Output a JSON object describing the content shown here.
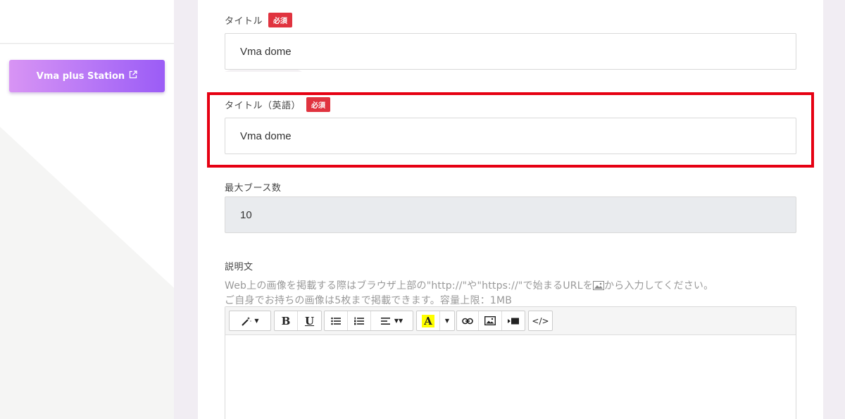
{
  "sidebar": {
    "station_button": {
      "label": "Vma plus Station",
      "icon": "external-link-icon"
    }
  },
  "form": {
    "title": {
      "label": "タイトル",
      "required_badge": "必須",
      "value": "Vma dome"
    },
    "title_en": {
      "label": "タイトル（英語）",
      "required_badge": "必須",
      "value": "Vma dome"
    },
    "max_booths": {
      "label": "最大ブース数",
      "value": "10"
    },
    "description": {
      "label": "説明文",
      "hint_line1_before_icon": "Web上の画像を掲載する際はブラウザ上部の\"http://\"や\"https://\"で始まるURLを",
      "hint_line1_after_icon": "から入力してください。",
      "hint_line2": "ご自身でお持ちの画像は5枚まで掲載できます。容量上限：1MB"
    }
  },
  "editor_toolbar": {
    "bold": "B",
    "underline": "U",
    "highlight": "A",
    "code": "</>",
    "icons": [
      "magic-wand-icon",
      "bold-icon",
      "underline-icon",
      "unordered-list-icon",
      "ordered-list-icon",
      "align-icon",
      "text-color-icon",
      "link-icon",
      "picture-icon",
      "video-icon",
      "code-view-icon"
    ]
  },
  "colors": {
    "required_badge": "#e0333f",
    "highlight_border": "#e60012",
    "station_gradient_start": "#d894f4",
    "station_gradient_end": "#9b5cf6"
  }
}
